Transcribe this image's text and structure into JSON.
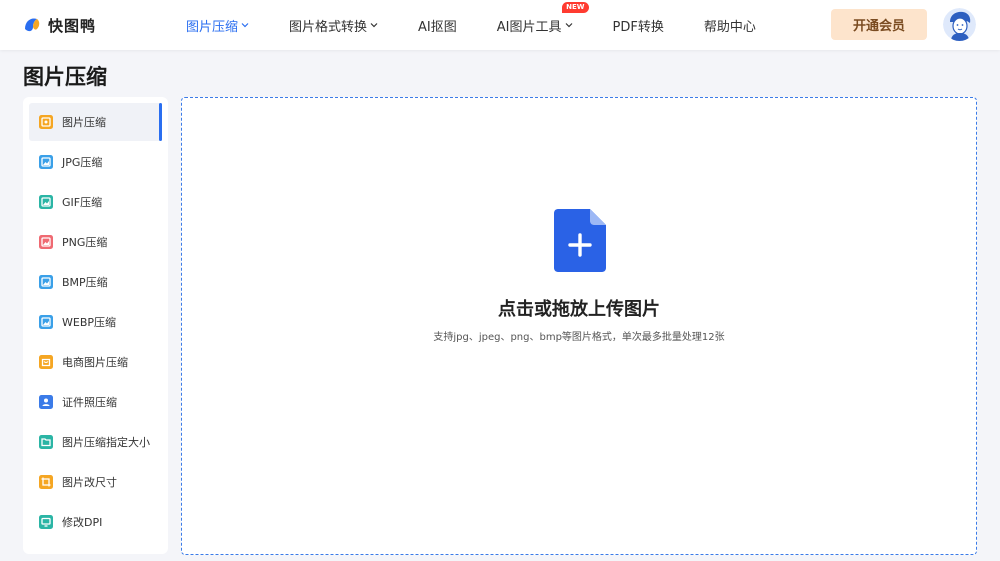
{
  "header": {
    "logo_text": "快图鸭",
    "nav": [
      {
        "label": "图片压缩",
        "has_dropdown": true,
        "active": true
      },
      {
        "label": "图片格式转换",
        "has_dropdown": true
      },
      {
        "label": "AI抠图",
        "has_dropdown": false
      },
      {
        "label": "AI图片工具",
        "has_dropdown": true,
        "badge": "NEW"
      },
      {
        "label": "PDF转换",
        "has_dropdown": false
      },
      {
        "label": "帮助中心",
        "has_dropdown": false
      }
    ],
    "vip_label": "开通会员"
  },
  "page_title": "图片压缩",
  "sidebar": {
    "items": [
      {
        "label": "图片压缩",
        "icon": "image-compress-icon",
        "color": "#f5a623",
        "active": true
      },
      {
        "label": "JPG压缩",
        "icon": "jpg-icon",
        "color": "#3aa0e8"
      },
      {
        "label": "GIF压缩",
        "icon": "gif-icon",
        "color": "#2bb5a5"
      },
      {
        "label": "PNG压缩",
        "icon": "png-icon",
        "color": "#ef6a72"
      },
      {
        "label": "BMP压缩",
        "icon": "bmp-icon",
        "color": "#3aa0e8"
      },
      {
        "label": "WEBP压缩",
        "icon": "webp-icon",
        "color": "#3aa0e8"
      },
      {
        "label": "电商图片压缩",
        "icon": "ecommerce-icon",
        "color": "#f5a623"
      },
      {
        "label": "证件照压缩",
        "icon": "id-photo-icon",
        "color": "#3b7be8"
      },
      {
        "label": "图片压缩指定大小",
        "icon": "folder-size-icon",
        "color": "#2bb5a5"
      },
      {
        "label": "图片改尺寸",
        "icon": "resize-icon",
        "color": "#f5a623"
      },
      {
        "label": "修改DPI",
        "icon": "monitor-dpi-icon",
        "color": "#2bb5a5"
      }
    ]
  },
  "upload": {
    "title": "点击或拖放上传图片",
    "subtitle": "支持jpg、jpeg、png、bmp等图片格式，单次最多批量处理12张"
  },
  "colors": {
    "accent": "#2a6ef0",
    "vip_bg": "#fde4cc",
    "file_icon": "#2a62e6"
  }
}
